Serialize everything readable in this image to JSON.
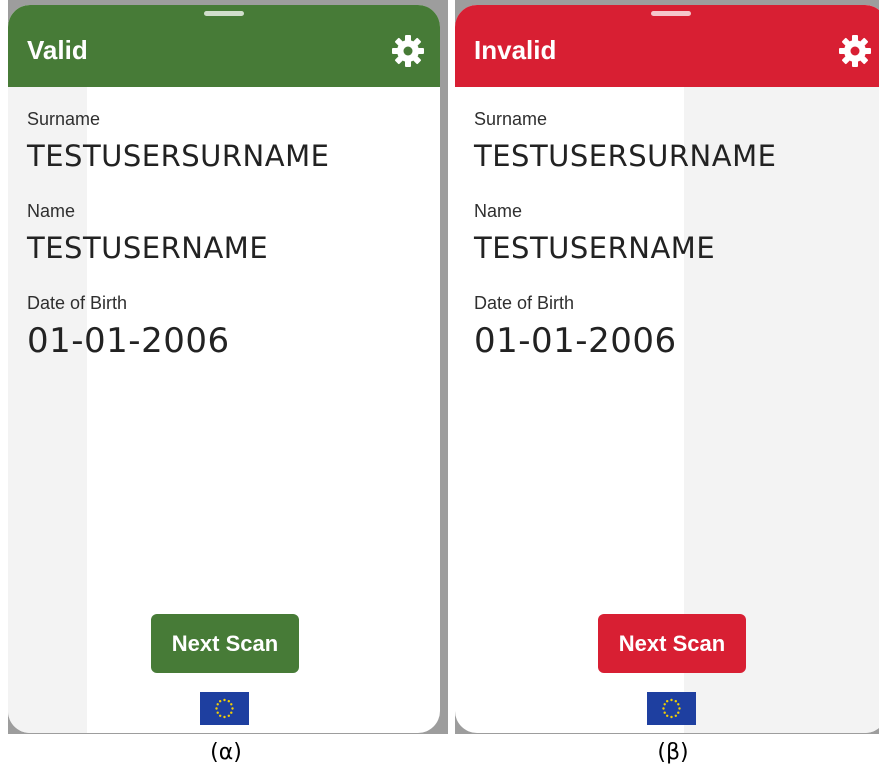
{
  "panels": [
    {
      "status": "Valid",
      "accent_color": "#477b37",
      "fields": {
        "surname_label": "Surname",
        "surname_value": "TESTUSERSURNAME",
        "name_label": "Name",
        "name_value": "TESTUSERNAME",
        "dob_label": "Date of Birth",
        "dob_value": "01-01-2006"
      },
      "next_button_label": "Next Scan",
      "settings_icon": "gear-icon",
      "footer_icon": "eu-flag-icon",
      "caption": "(α)"
    },
    {
      "status": "Invalid",
      "accent_color": "#d81f33",
      "fields": {
        "surname_label": "Surname",
        "surname_value": "TESTUSERSURNAME",
        "name_label": "Name",
        "name_value": "TESTUSERNAME",
        "dob_label": "Date of Birth",
        "dob_value": "01-01-2006"
      },
      "next_button_label": "Next Scan",
      "settings_icon": "gear-icon",
      "footer_icon": "eu-flag-icon",
      "caption": "(β)"
    }
  ]
}
